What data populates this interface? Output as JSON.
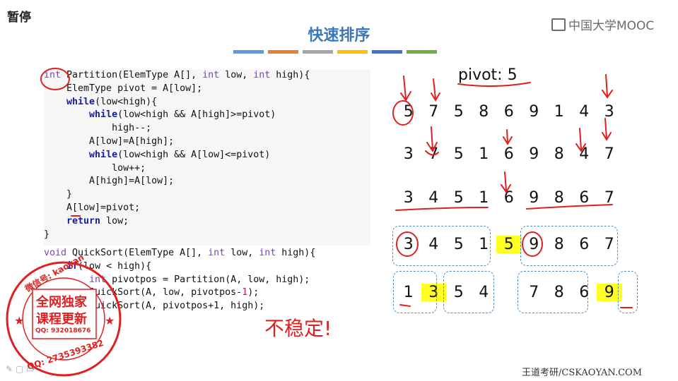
{
  "header": {
    "pause_label": "暂停",
    "logo_text": "中国大学MOOC",
    "title": "快速排序",
    "accent_bars": [
      "#5b9bd5",
      "#ed7d31",
      "#a5a5a5",
      "#ffc000",
      "#4472c4",
      "#70ad47"
    ]
  },
  "code": {
    "partition_lines": [
      [
        "int",
        " Partition(ElemType A[], ",
        "int",
        " low, ",
        "int",
        " high){"
      ],
      [
        "",
        "    ElemType pivot = A[low];"
      ],
      [
        "while",
        "    (low<high){"
      ],
      [
        "while",
        "        (low<high && A[high]>=pivot)"
      ],
      [
        "",
        "            high--;"
      ],
      [
        "",
        "        A[low]=A[high];"
      ],
      [
        "while",
        "        (low<high && A[low]<=pivot)"
      ],
      [
        "",
        "            low++;"
      ],
      [
        "",
        "        A[high]=A[low];"
      ],
      [
        "",
        "    }"
      ],
      [
        "",
        "    A[low]=pivot;"
      ],
      [
        "return",
        "    low;"
      ],
      [
        "",
        "}"
      ]
    ],
    "text": {
      "l1": "int Partition(ElemType A[], int low, int high){",
      "l2": "    ElemType pivot = A[low];",
      "l3": "    while(low<high){",
      "l4": "        while(low<high && A[high]>=pivot)",
      "l5": "            high--;",
      "l6": "        A[low]=A[high];",
      "l7": "        while(low<high && A[low]<=pivot)",
      "l8": "            low++;",
      "l9": "        A[high]=A[low];",
      "l10": "    }",
      "l11": "    A[low]=pivot;",
      "l12": "    return low;",
      "l13": "}",
      "q1": "void QuickSort(ElemType A[], int low, int high){",
      "q2": "    if(low < high){",
      "q3": "        int pivotpos = Partition(A, low, high);",
      "q4": "        QuickSort(A, low, pivotpos-1);",
      "q5": "        QuickSort(A, pivotpos+1, high);",
      "q6": "    }",
      "q7": "}"
    }
  },
  "demo": {
    "pivot_label": "pivot: 5",
    "rows": [
      [
        "5",
        "7",
        "5",
        "8",
        "6",
        "9",
        "1",
        "4",
        "3"
      ],
      [
        "3",
        "7",
        "5",
        "1",
        "6",
        "9",
        "8",
        "4",
        "7"
      ],
      [
        "3",
        "4",
        "5",
        "1",
        "6",
        "9",
        "8",
        "6",
        "7"
      ],
      [
        "3",
        "4",
        "5",
        "1",
        "5",
        "9",
        "8",
        "6",
        "7"
      ],
      [
        "1",
        "3",
        "5",
        "4",
        "",
        "7",
        "8",
        "6",
        "9"
      ]
    ],
    "note": "不稳定!"
  },
  "stamp": {
    "wechat": "微信号: kaoyan",
    "line1": "全网独家",
    "line2": "课程更新",
    "qq_small": "QQ: 932018676",
    "qq_big": "QQ: 2735393382"
  },
  "footer": {
    "credit": "王道考研/CSKAOYAN.COM"
  },
  "colors": {
    "title": "#3c78b8",
    "ink": "#e02020",
    "highlight": "#ffff22",
    "box": "#4f8fbf"
  }
}
